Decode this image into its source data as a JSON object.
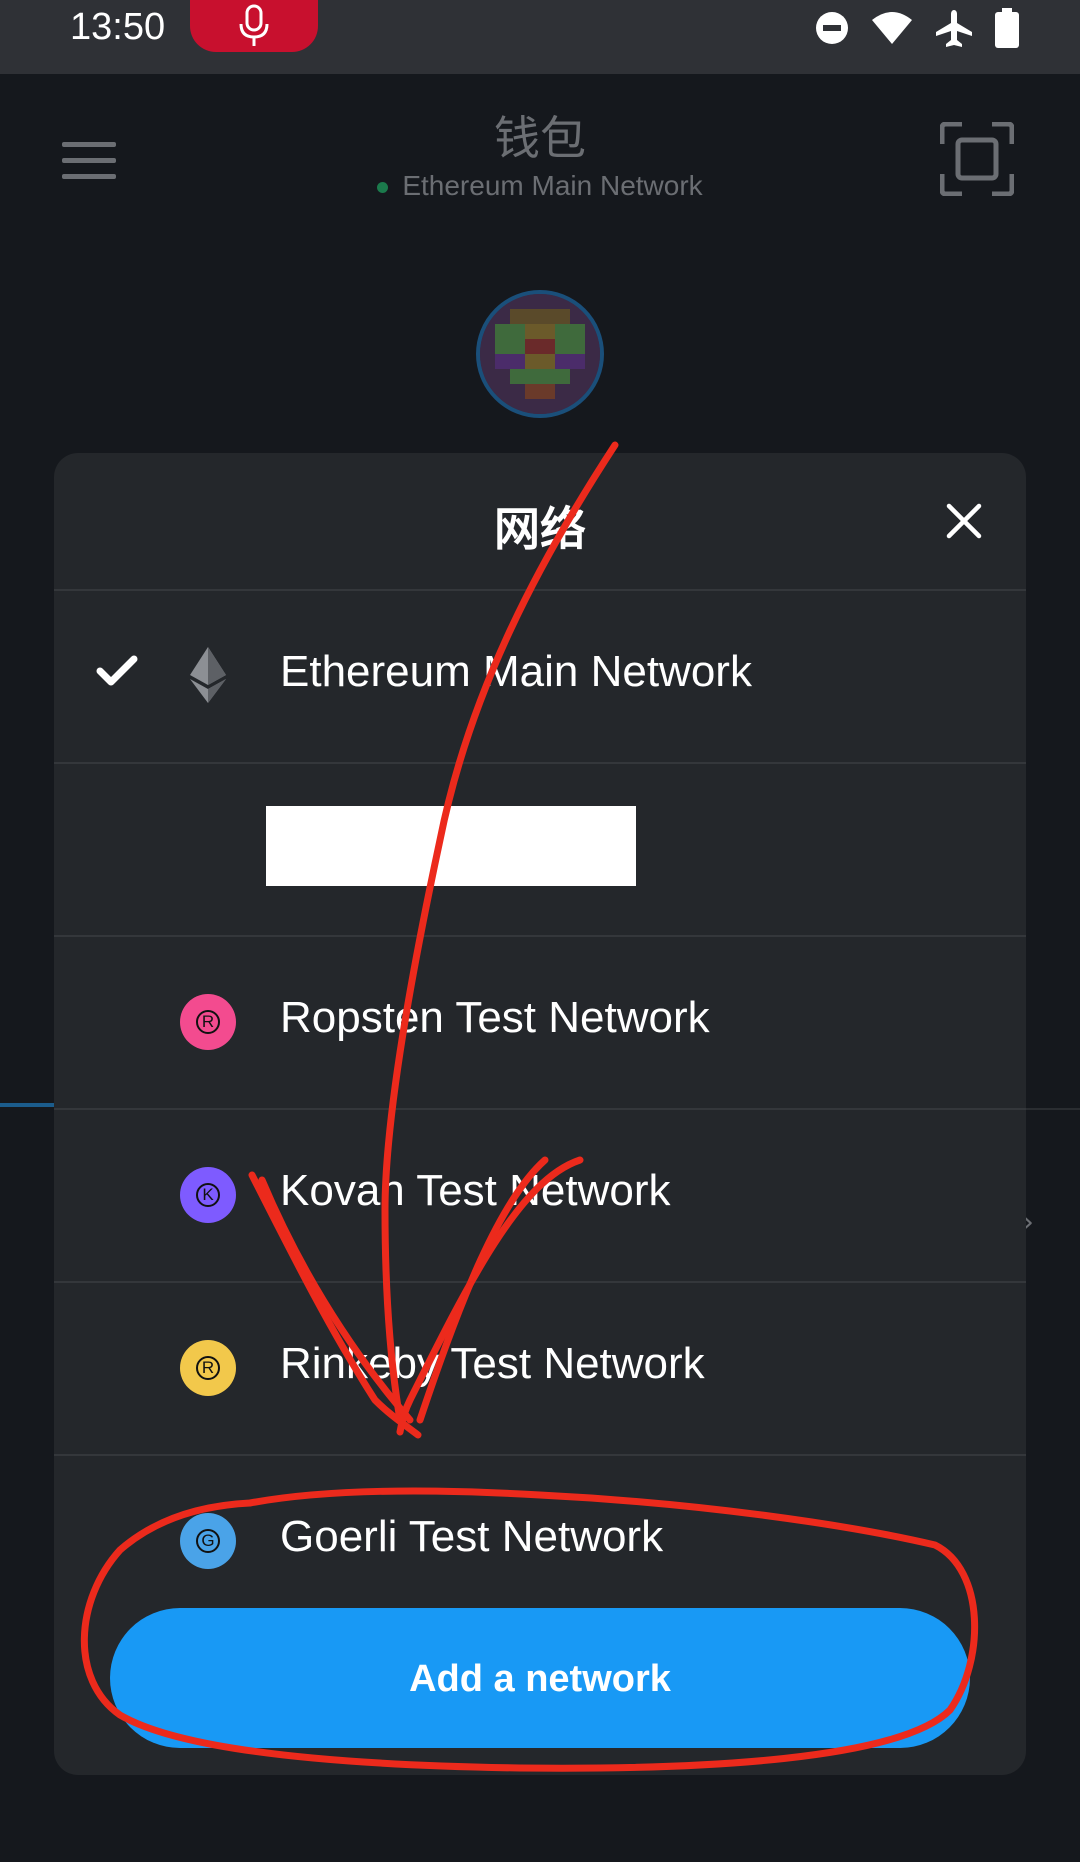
{
  "status_bar": {
    "time": "13:50",
    "icons": [
      "mic-icon",
      "dnd-icon",
      "wifi-icon",
      "airplane-icon",
      "battery-icon"
    ]
  },
  "header": {
    "title": "钱包",
    "network": "Ethereum Main Network",
    "network_dot_color": "#1b7a4c"
  },
  "modal": {
    "title": "网络",
    "networks": [
      {
        "label": "Ethereum Main Network",
        "selected": true,
        "icon": "ethereum-icon"
      },
      {
        "label": "",
        "redacted": true
      },
      {
        "label": "Ropsten Test Network",
        "badge": "R",
        "color": "#f34b8f"
      },
      {
        "label": "Kovan Test Network",
        "badge": "K",
        "color": "#7e5bff"
      },
      {
        "label": "Rinkeby Test Network",
        "badge": "R",
        "color": "#f2c84b"
      },
      {
        "label": "Goerli Test Network",
        "badge": "G",
        "color": "#4aa3e8"
      }
    ],
    "add_button": "Add a network"
  },
  "colors": {
    "accent": "#1899f5",
    "annotation": "#ec2a1c"
  }
}
